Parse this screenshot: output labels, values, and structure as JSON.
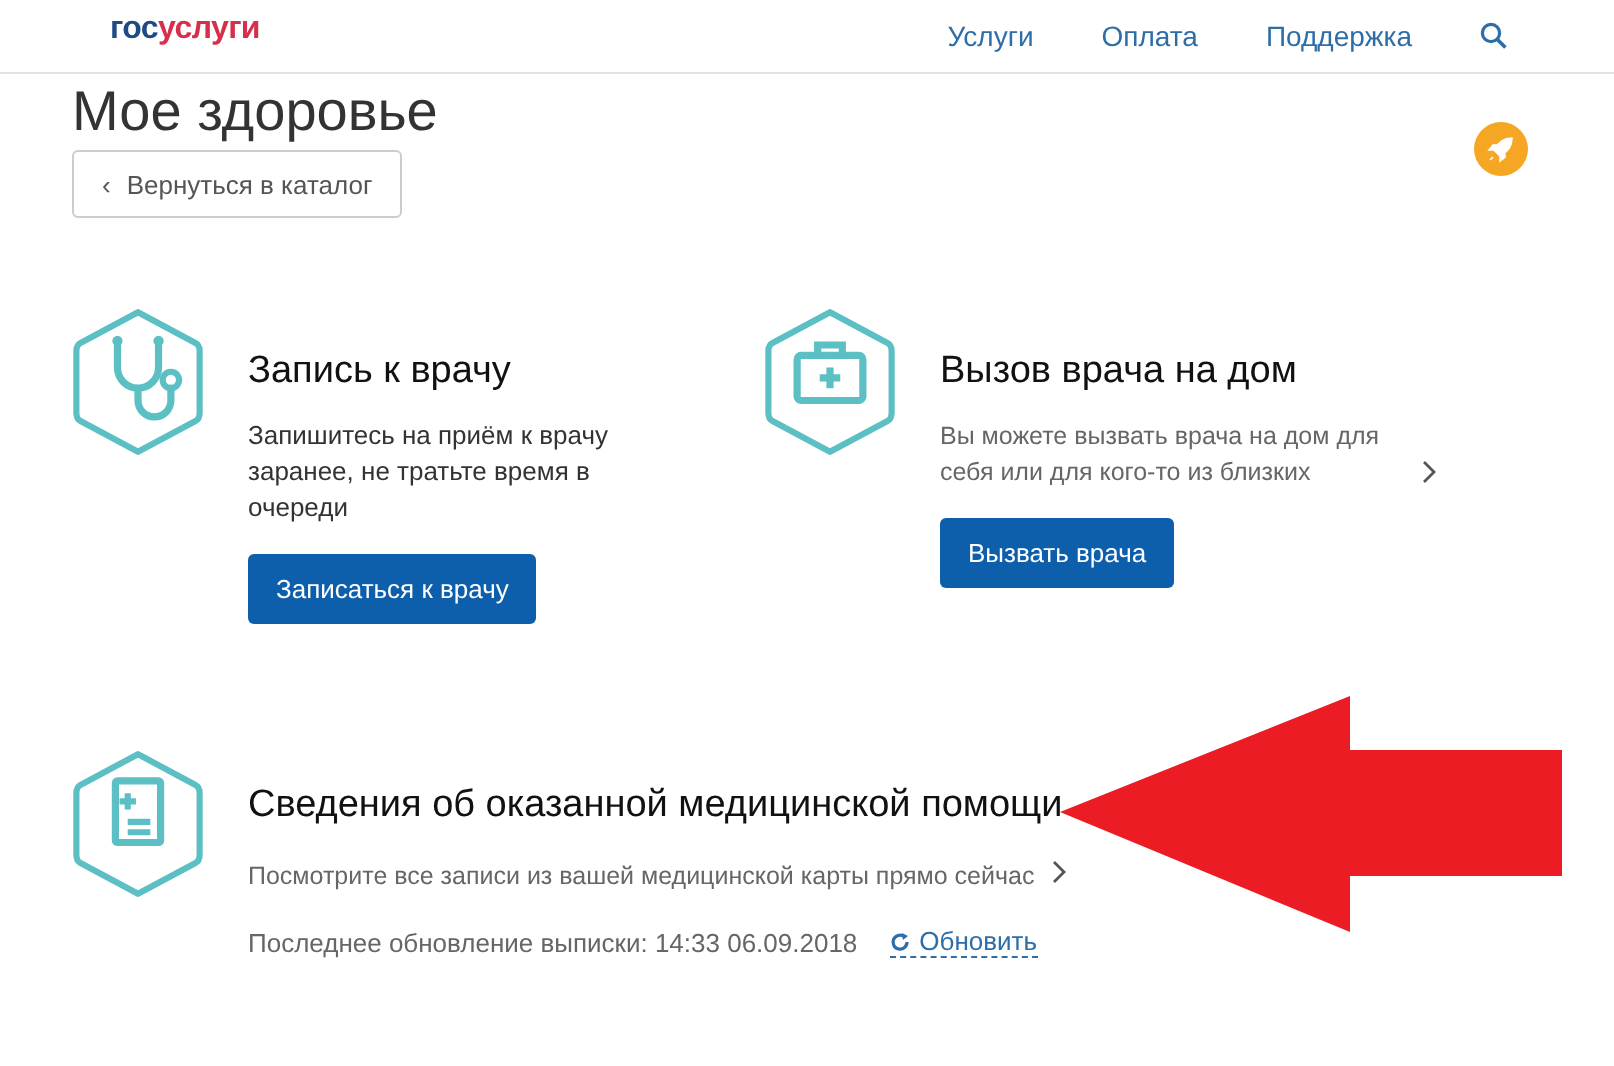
{
  "header": {
    "logo": {
      "part_1": "гос",
      "part_2": "услуги"
    },
    "nav": [
      "Услуги",
      "Оплата",
      "Поддержка"
    ]
  },
  "page_title": "Мое здоровье",
  "back_button": {
    "icon": "‹",
    "label": "Вернуться в каталог"
  },
  "services": [
    {
      "kind": "stethoscope",
      "title": "Запись к врачу",
      "description": "Запишитесь на приём к врачу заранее, не тратьте время в очереди",
      "has_chevron": false,
      "button": "Записаться к врачу"
    },
    {
      "kind": "medkit",
      "title": "Вызов врача на дом",
      "description": "Вы можете вызвать врача на дом для себя или для кого-то из близких",
      "has_chevron": true,
      "button": "Вызвать врача"
    }
  ],
  "records": {
    "kind": "document",
    "title": "Сведения об оказанной медицинской помощи",
    "description": "Посмотрите все записи из вашей медицинской карты прямо сейчас",
    "has_chevron": true,
    "last_update": "Последнее обновление выписки: 14:33 06.09.2018",
    "refresh": "Обновить"
  }
}
